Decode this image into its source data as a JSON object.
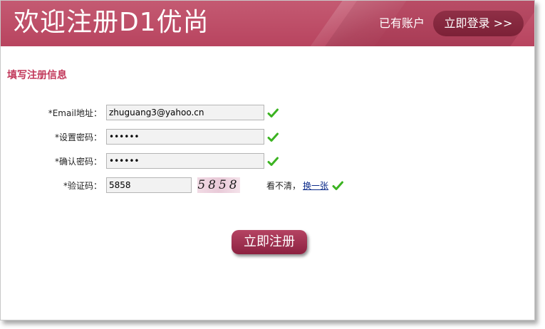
{
  "header": {
    "title": "欢迎注册D1优尚",
    "has_account": "已有账户",
    "login_button": "立即登录 >>"
  },
  "form": {
    "section_title": "填写注册信息",
    "email": {
      "label": "*Email地址：",
      "value": "zhuguang3@yahoo.cn",
      "valid": true
    },
    "password": {
      "label": "*设置密码：",
      "value": "••••••",
      "valid": true
    },
    "confirm_password": {
      "label": "*确认密码：",
      "value": "••••••",
      "valid": true
    },
    "captcha": {
      "label": "*验证码：",
      "value": "5858",
      "image_text": "5858",
      "unclear_text": "看不清，",
      "refresh_link": "换一张",
      "valid": true
    },
    "submit_button": "立即注册"
  },
  "colors": {
    "header_bg": "#b8445f",
    "login_button_bg": "#7c2137",
    "section_title": "#c2385a",
    "check_green": "#3bb321",
    "submit_bg": "#8c2140"
  },
  "icons": {
    "valid": "green-check-icon"
  }
}
